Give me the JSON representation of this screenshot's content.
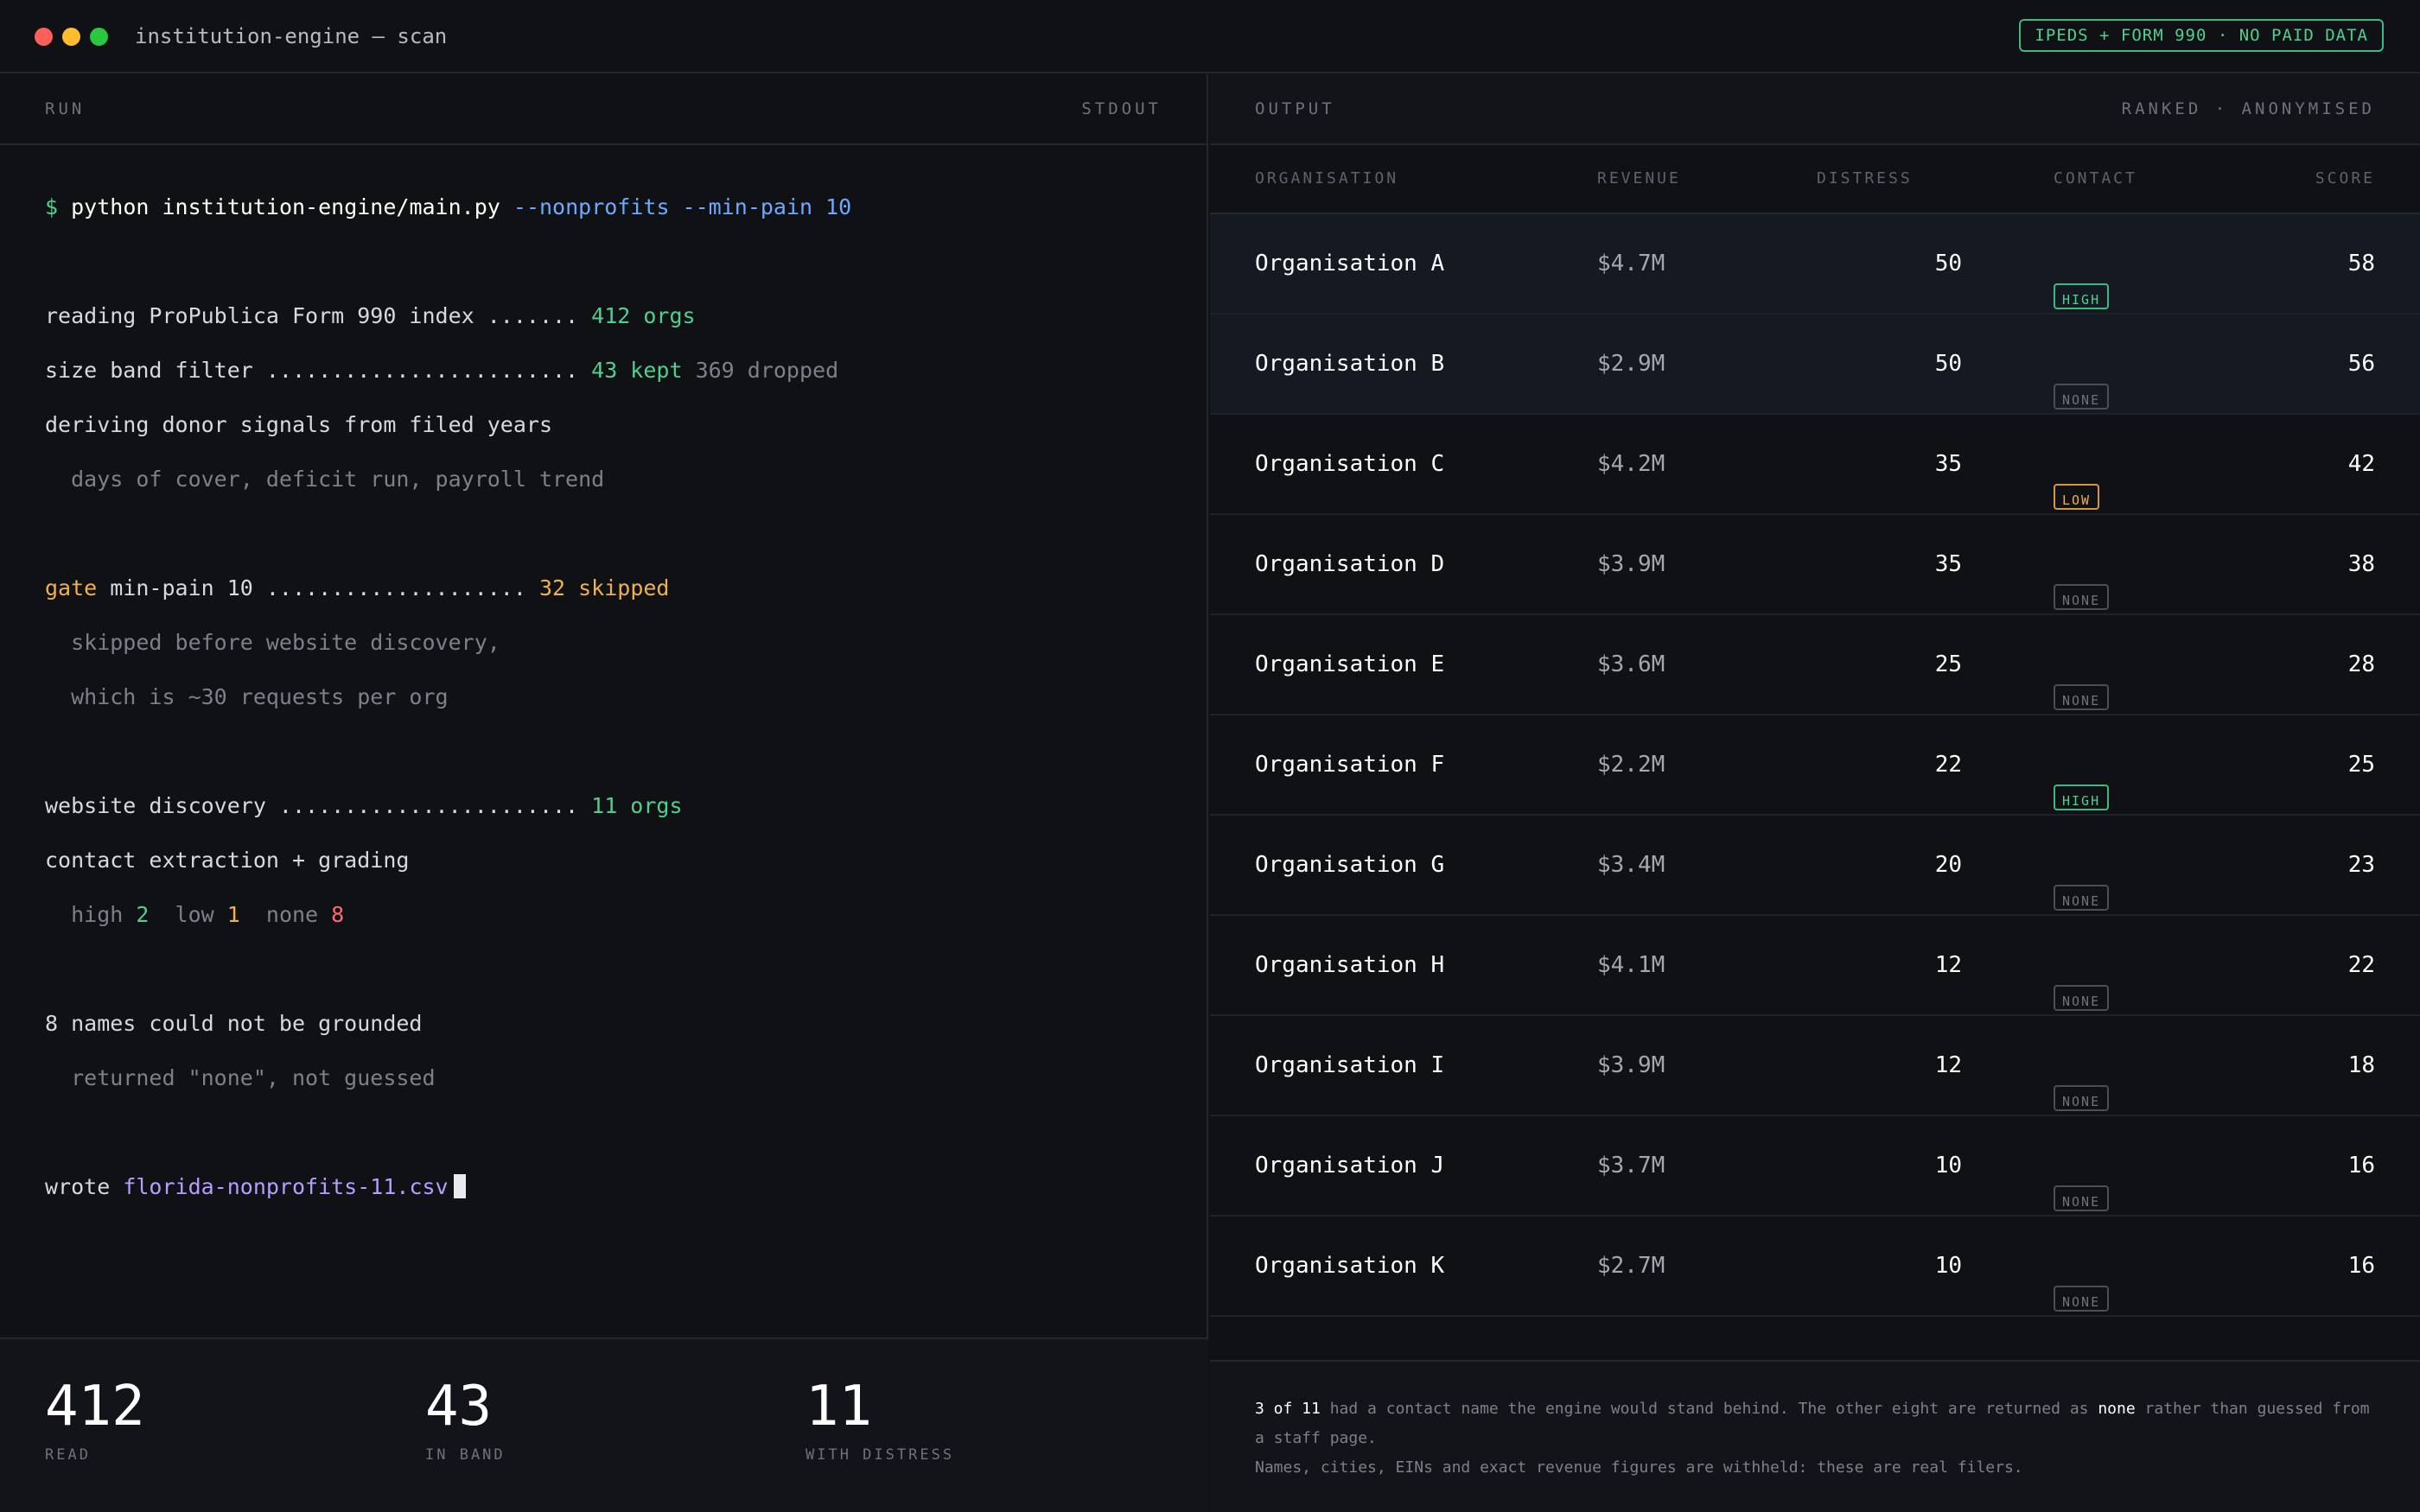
{
  "window": {
    "title": "institution-engine — scan",
    "badge": "IPEDS + FORM 990 · NO PAID DATA"
  },
  "left_pane": {
    "label": "RUN",
    "stream": "STDOUT",
    "command": {
      "prompt": "$",
      "cmd": "python institution-engine/main.py",
      "flags": "--nonprofits --min-pain 10"
    },
    "lines": {
      "l1": {
        "text": "reading ProPublica Form 990 index ....... ",
        "value": "412 orgs"
      },
      "l2": {
        "text": "size band filter ........................ ",
        "kept": "43 kept",
        "dropped": " 369 dropped"
      },
      "l3": "deriving donor signals from filed years",
      "l4": "  days of cover, deficit run, payroll trend",
      "l5": {
        "gate": "gate",
        "text": " min-pain 10 .................... ",
        "value": "32 skipped"
      },
      "l6": "  skipped before website discovery,",
      "l7": "  which is ~30 requests per org",
      "l8": {
        "text": "website discovery ....................... ",
        "value": "11 orgs"
      },
      "l9": "contact extraction + grading",
      "l10": {
        "high_label": "  high ",
        "high": "2",
        "low_label": "  low ",
        "low": "1",
        "none_label": "  none ",
        "none": "8"
      },
      "l11": "8 names could not be grounded",
      "l12": "  returned \"none\", not guessed",
      "l13": {
        "text": "wrote ",
        "file": "florida-nonprofits-11.csv"
      }
    },
    "stats": [
      {
        "value": "412",
        "label": "READ"
      },
      {
        "value": "43",
        "label": "IN BAND"
      },
      {
        "value": "11",
        "label": "WITH DISTRESS"
      }
    ]
  },
  "right_pane": {
    "label": "OUTPUT",
    "meta": "RANKED · ANONYMISED",
    "columns": [
      "ORGANISATION",
      "REVENUE",
      "DISTRESS",
      "CONTACT",
      "SCORE"
    ],
    "rows": [
      {
        "org": "Organisation A",
        "revenue": "$4.7M",
        "distress": "50",
        "contact": "HIGH",
        "score": "58"
      },
      {
        "org": "Organisation B",
        "revenue": "$2.9M",
        "distress": "50",
        "contact": "NONE",
        "score": "56"
      },
      {
        "org": "Organisation C",
        "revenue": "$4.2M",
        "distress": "35",
        "contact": "LOW",
        "score": "42"
      },
      {
        "org": "Organisation D",
        "revenue": "$3.9M",
        "distress": "35",
        "contact": "NONE",
        "score": "38"
      },
      {
        "org": "Organisation E",
        "revenue": "$3.6M",
        "distress": "25",
        "contact": "NONE",
        "score": "28"
      },
      {
        "org": "Organisation F",
        "revenue": "$2.2M",
        "distress": "22",
        "contact": "HIGH",
        "score": "25"
      },
      {
        "org": "Organisation G",
        "revenue": "$3.4M",
        "distress": "20",
        "contact": "NONE",
        "score": "23"
      },
      {
        "org": "Organisation H",
        "revenue": "$4.1M",
        "distress": "12",
        "contact": "NONE",
        "score": "22"
      },
      {
        "org": "Organisation I",
        "revenue": "$3.9M",
        "distress": "12",
        "contact": "NONE",
        "score": "18"
      },
      {
        "org": "Organisation J",
        "revenue": "$3.7M",
        "distress": "10",
        "contact": "NONE",
        "score": "16"
      },
      {
        "org": "Organisation K",
        "revenue": "$2.7M",
        "distress": "10",
        "contact": "NONE",
        "score": "16"
      }
    ],
    "note": {
      "p1a": "3 of 11",
      "p1b": " had a contact name the engine would stand behind. The other eight are returned as ",
      "p1c": "none",
      "p1d": " rather than guessed from a staff page.",
      "p2": "Names, cities, EINs and exact revenue figures are withheld: these are real filers."
    }
  },
  "colors": {
    "accent_green": "#4fd08f",
    "accent_blue": "#6ea8ff",
    "accent_amber": "#f0b14a",
    "accent_red": "#ff6b6b",
    "accent_purple": "#b99cff"
  }
}
